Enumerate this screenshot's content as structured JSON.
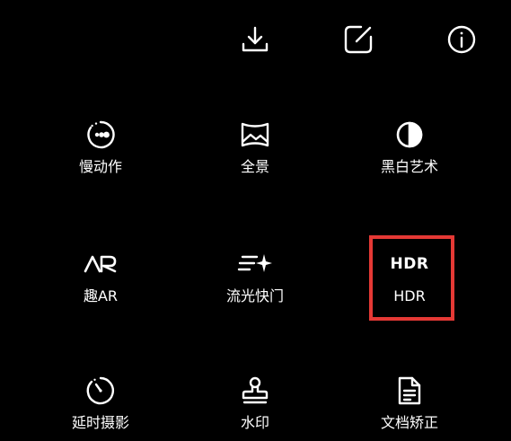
{
  "toolbar": {
    "download_icon": "download-icon",
    "edit_icon": "edit-icon",
    "info_icon": "info-icon"
  },
  "modes": [
    {
      "label": "慢动作",
      "icon": "slow-motion-icon"
    },
    {
      "label": "全景",
      "icon": "panorama-icon"
    },
    {
      "label": "黑白艺术",
      "icon": "monochrome-icon"
    },
    {
      "label": "趣AR",
      "icon": "ar-icon",
      "icon_text": "AR"
    },
    {
      "label": "流光快门",
      "icon": "light-painting-icon"
    },
    {
      "label": "HDR",
      "icon": "hdr-icon",
      "icon_text": "HDR"
    },
    {
      "label": "延时摄影",
      "icon": "timelapse-icon"
    },
    {
      "label": "水印",
      "icon": "watermark-icon"
    },
    {
      "label": "文档矫正",
      "icon": "document-correction-icon"
    }
  ],
  "highlight": {
    "target": "HDR",
    "color": "#e53935"
  },
  "colors": {
    "background": "#000000",
    "foreground": "#ffffff"
  }
}
